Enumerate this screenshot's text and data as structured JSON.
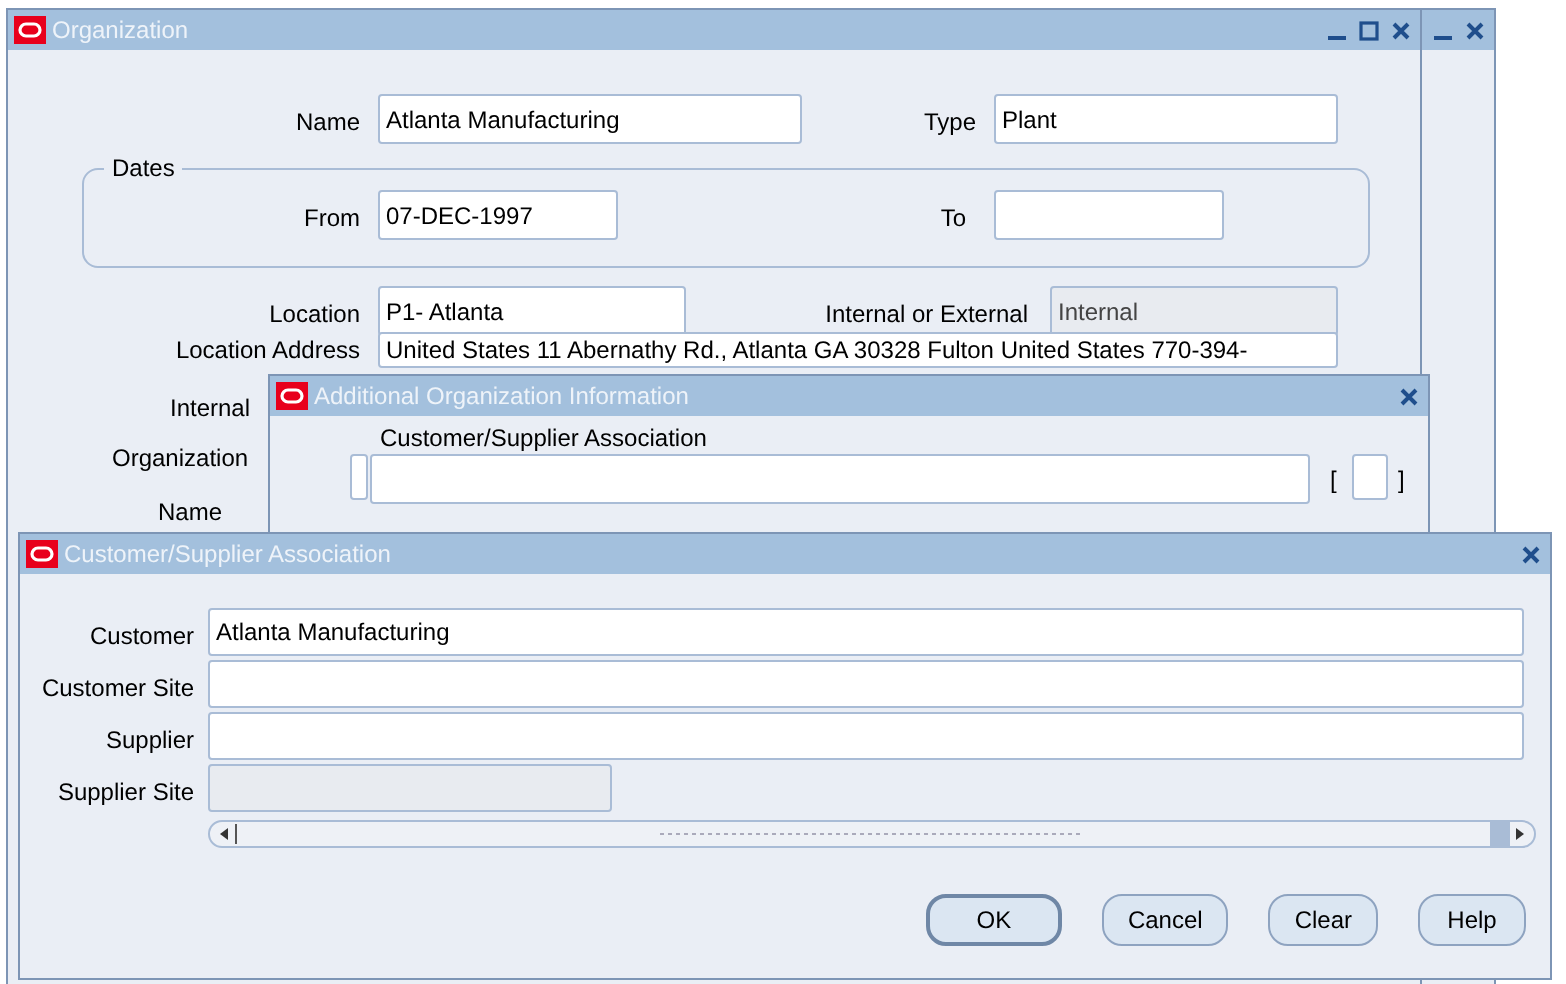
{
  "organization_window": {
    "title": "Organization",
    "name": {
      "label": "Name",
      "value": "Atlanta Manufacturing"
    },
    "type": {
      "label": "Type",
      "value": "Plant"
    },
    "dates": {
      "label": "Dates",
      "from": {
        "label": "From",
        "value": "07-DEC-1997"
      },
      "to": {
        "label": "To"
      }
    },
    "location": {
      "label": "Location",
      "value": "P1- Atlanta"
    },
    "internal_or_external": {
      "label": "Internal or External",
      "value": "Internal",
      "disabled": true
    },
    "location_address": {
      "label": "Location Address",
      "value": "United States 11 Abernathy Rd., Atlanta GA 30328 Fulton United States 770-394-"
    },
    "internal_label": "Internal",
    "group_label": "Organization",
    "group_name_label": "Name"
  },
  "additional_window": {
    "title": "Additional Organization Information",
    "field_label": "Customer/Supplier Association",
    "brackets": [
      "[",
      "]"
    ],
    "checked": false
  },
  "association_window": {
    "title": "Customer/Supplier Association",
    "fields": [
      {
        "label": "Customer",
        "value": "Atlanta Manufacturing",
        "disabled": false
      },
      {
        "label": "Customer Site",
        "disabled": false
      },
      {
        "label": "Supplier",
        "disabled": false
      },
      {
        "label": "Supplier Site",
        "disabled": true
      }
    ],
    "buttons": [
      {
        "label": "OK",
        "default": true
      },
      {
        "label": "Cancel",
        "default": false
      },
      {
        "label": "Clear",
        "default": false
      },
      {
        "label": "Help",
        "default": false
      }
    ]
  }
}
